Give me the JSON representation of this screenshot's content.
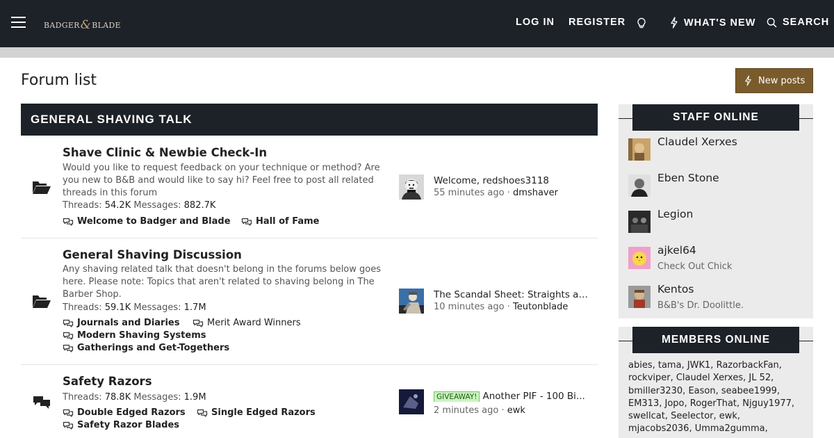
{
  "header": {
    "logo_left": "BADGER",
    "logo_amp": "&",
    "logo_right": "BLADE",
    "nav": {
      "login": "LOG IN",
      "register": "REGISTER",
      "whats_new": "WHAT'S NEW",
      "search": "SEARCH"
    },
    "icons": [
      "menu-icon",
      "lightbulb-icon",
      "bolt-icon",
      "search-icon"
    ]
  },
  "page": {
    "title": "Forum list",
    "new_posts_label": "New posts"
  },
  "category": {
    "title": "GENERAL SHAVING TALK",
    "nodes": [
      {
        "title": "Shave Clinic & Newbie Check-In",
        "description": "Would you like to request feedback on your technique or method? Are you new to B&B and would like to say hi? Feel free to post all related threads in this forum",
        "threads_label": "Threads:",
        "threads": "54.2K",
        "messages_label": "Messages:",
        "messages": "882.7K",
        "subforums": [
          {
            "label": "Welcome to Badger and Blade",
            "bold": true
          },
          {
            "label": "Hall of Fame",
            "bold": true
          }
        ],
        "latest": {
          "title": "Welcome, redshoes3118",
          "time": "55 minutes ago",
          "sep": "·",
          "user": "dmshaver"
        }
      },
      {
        "title": "General Shaving Discussion",
        "description": "Any shaving related talk that doesn't belong in the forums below goes here. Please note: Topics that aren't related to shaving belong in The Barber Shop.",
        "threads_label": "Threads:",
        "threads": "59.1K",
        "messages_label": "Messages:",
        "messages": "1.7M",
        "subforums": [
          {
            "label": "Journals and Diaries",
            "bold": true
          },
          {
            "label": "Merit Award Winners",
            "bold": false
          },
          {
            "label": "Modern Shaving Systems",
            "bold": true
          },
          {
            "label": "Gatherings and Get-Togethers",
            "bold": true
          }
        ],
        "latest": {
          "title": "The Scandal Sheet: Straights and Shavettes",
          "time": "10 minutes ago",
          "sep": "·",
          "user": "Teutonblade"
        }
      },
      {
        "title": "Safety Razors",
        "threads_label": "Threads:",
        "threads": "78.8K",
        "messages_label": "Messages:",
        "messages": "1.9M",
        "subforums": [
          {
            "label": "Double Edged Razors",
            "bold": true
          },
          {
            "label": "Single Edged Razors",
            "bold": true
          },
          {
            "label": "Safety Razor Blades",
            "bold": true
          }
        ],
        "latest": {
          "prefix": "GIVEAWAY!",
          "title": "Another PIF - 100 Bi...",
          "time": "2 minutes ago",
          "sep": "·",
          "user": "ewk"
        }
      }
    ]
  },
  "sidebar": {
    "staff_title": "STAFF ONLINE",
    "staff": [
      {
        "name": "Claudel Xerxes",
        "title": ""
      },
      {
        "name": "Eben Stone",
        "title": ""
      },
      {
        "name": "Legion",
        "title": ""
      },
      {
        "name": "ajkel64",
        "title": "Check Out Chick"
      },
      {
        "name": "Kentos",
        "title": "B&B's Dr. Doolittle."
      }
    ],
    "members_title": "MEMBERS ONLINE",
    "members_text": "abies, tama, JWK1, RazorbackFan, rockviper, Claudel Xerxes, JL 52, bmiller3230, Eason, seabee1999, EM313, Jopo, RogerThat, Njguy1977, swellcat, Seelector, ewk, mjacobs2036, Umma2gumma,"
  },
  "colors": {
    "header_bg": "#1d2128",
    "accent_button": "#7a5b2c",
    "sidebar_bg": "#ebebeb",
    "prefix_green": "#c9f5c0"
  }
}
